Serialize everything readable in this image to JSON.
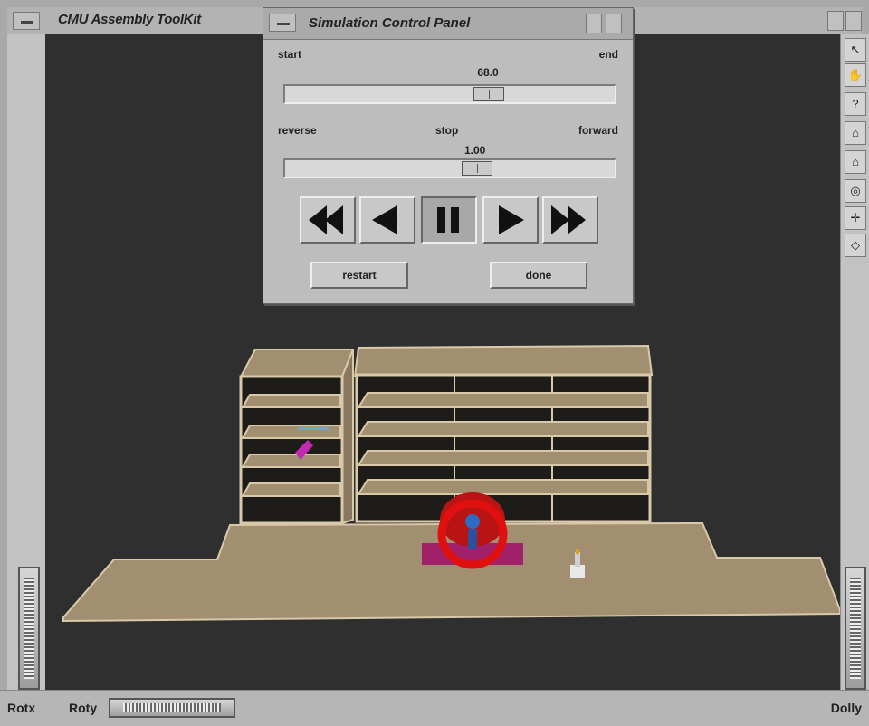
{
  "main_window": {
    "title": "CMU Assembly ToolKit"
  },
  "panel": {
    "title": "Simulation Control Panel",
    "time_slider": {
      "left_label": "start",
      "right_label": "end",
      "value": "68.0",
      "fraction": 0.63
    },
    "speed_slider": {
      "left_label": "reverse",
      "center_label": "stop",
      "right_label": "forward",
      "value": "1.00",
      "fraction": 0.59
    },
    "transport": [
      {
        "name": "fast-rewind",
        "icon": "fast-rewind-icon"
      },
      {
        "name": "play-reverse",
        "icon": "reverse-play-icon"
      },
      {
        "name": "pause",
        "icon": "pause-icon",
        "active": true
      },
      {
        "name": "play-forward",
        "icon": "play-icon"
      },
      {
        "name": "fast-forward",
        "icon": "fast-forward-icon"
      }
    ],
    "restart_label": "restart",
    "done_label": "done"
  },
  "viewer": {
    "toolbar_icons": [
      "pick-arrow-icon",
      "view-hand-icon",
      "help-icon",
      "home-icon",
      "set-home-icon",
      "view-all-icon",
      "seek-icon",
      "projection-icon"
    ],
    "rotx_label": "Rotx",
    "roty_label": "Roty",
    "dolly_label": "Dolly"
  },
  "colors": {
    "viewport_bg": "#2f2f2f",
    "wood": "#a08c70",
    "highlight_ring": "#e01010",
    "robot_base": "#a0206a"
  }
}
